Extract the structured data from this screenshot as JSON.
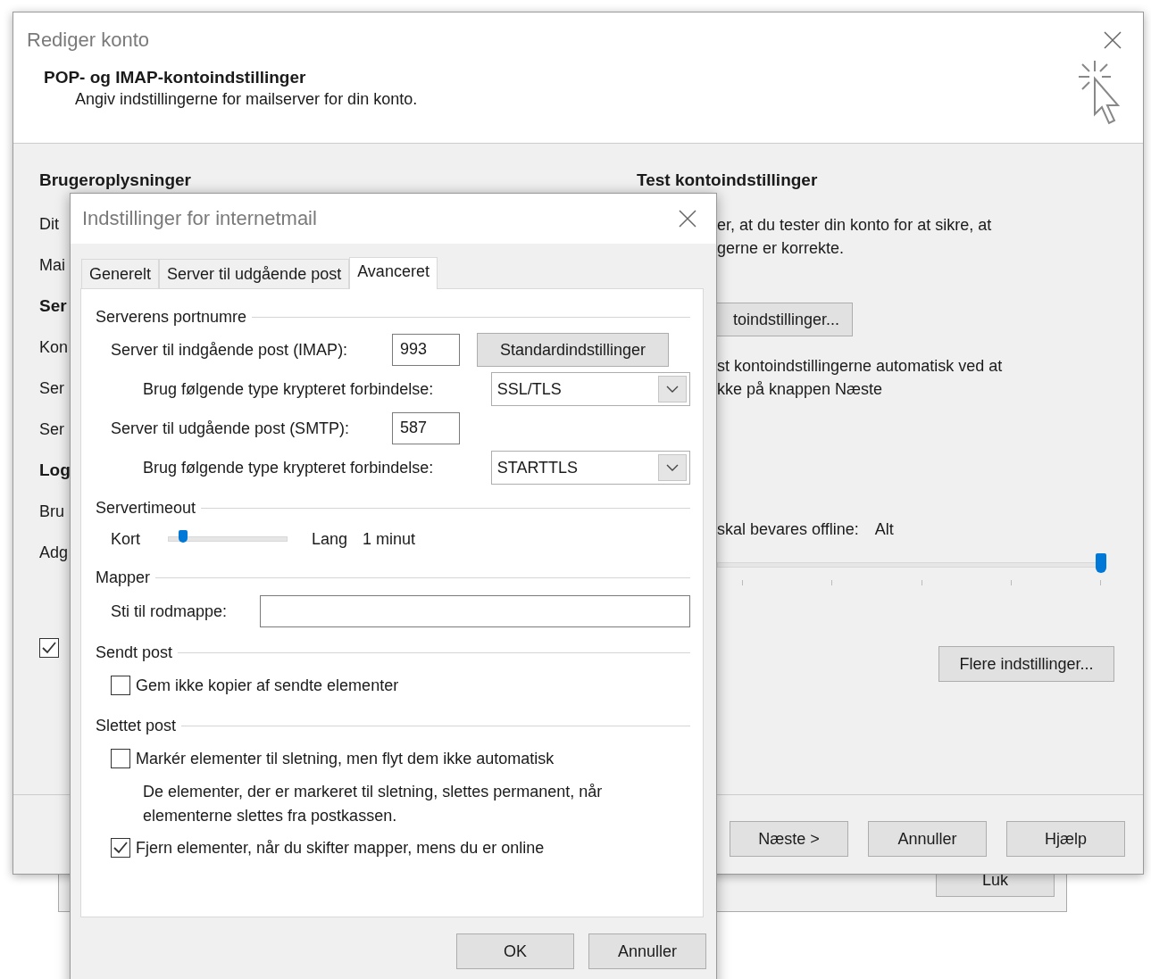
{
  "background_window": {
    "button": "Luk"
  },
  "window": {
    "title": "Rediger konto",
    "heading": "POP- og IMAP-kontoindstillinger",
    "subheading": "Angiv indstillingerne for mailserver for din konto.",
    "left_heading": "Brugeroplysninger",
    "left_fragments": [
      {
        "kind": "label",
        "text": "Dit"
      },
      {
        "kind": "label",
        "text": "Mai"
      },
      {
        "kind": "heading",
        "text": "Ser"
      },
      {
        "kind": "label",
        "text": "Kon"
      },
      {
        "kind": "label",
        "text": "Ser"
      },
      {
        "kind": "label",
        "text": "Ser"
      },
      {
        "kind": "heading",
        "text": "Log"
      },
      {
        "kind": "label",
        "text": "Bru"
      },
      {
        "kind": "label",
        "text": "Adg"
      },
      {
        "kind": "checkbox",
        "checked": true
      }
    ],
    "right_heading": "Test kontoindstillinger",
    "right_text": [
      "er, at du tester din konto for at sikre, at",
      "gerne er korrekte."
    ],
    "test_button": "toindstillinger...",
    "auto_text": [
      "st kontoindstillingerne automatisk ved at",
      "kke på knappen Næste"
    ],
    "offline_label": "skal bevares offline:",
    "offline_value": "Alt",
    "offline_slider": {
      "level": 1.0
    },
    "more_button": "Flere indstillinger...",
    "footer_buttons": [
      "Næste >",
      "Annuller",
      "Hjælp"
    ]
  },
  "dialog": {
    "title": "Indstillinger for internetmail",
    "tabs": [
      {
        "label": "Generelt",
        "selected": false
      },
      {
        "label": "Server til udgående post",
        "selected": false
      },
      {
        "label": "Avanceret",
        "selected": true
      }
    ],
    "groups": [
      {
        "title": "Serverens portnumre",
        "rows": [
          {
            "kind": "port",
            "label": "Server til indgående post (IMAP):",
            "value": "993",
            "button": "Standardindstillinger"
          },
          {
            "kind": "select",
            "label": "Brug følgende type krypteret forbindelse:",
            "value": "SSL/TLS"
          },
          {
            "kind": "port",
            "label": "Server til udgående post (SMTP):",
            "value": "587"
          },
          {
            "kind": "select",
            "label": "Brug følgende type krypteret forbindelse:",
            "value": "STARTTLS"
          }
        ]
      },
      {
        "title": "Servertimeout",
        "rows": [
          {
            "kind": "slider",
            "min_label": "Kort",
            "max_label": "Lang",
            "reading": "1 minut",
            "level": 0.1
          }
        ]
      },
      {
        "title": "Mapper",
        "rows": [
          {
            "kind": "text",
            "label": "Sti til rodmappe:"
          }
        ]
      },
      {
        "title": "Sendt post",
        "rows": [
          {
            "kind": "checkbox",
            "label": "Gem ikke kopier af sendte elementer",
            "checked": false
          }
        ]
      },
      {
        "title": "Slettet post",
        "rows": [
          {
            "kind": "checkbox",
            "label": "Markér elementer til sletning, men flyt dem ikke automatisk",
            "checked": false
          },
          {
            "kind": "note",
            "text": "De elementer, der er markeret til sletning, slettes permanent, når elementerne slettes fra postkassen."
          },
          {
            "kind": "checkbox",
            "label": "Fjern elementer, når du skifter mapper, mens du er online",
            "checked": true
          }
        ]
      }
    ],
    "buttons": [
      "OK",
      "Annuller"
    ]
  }
}
